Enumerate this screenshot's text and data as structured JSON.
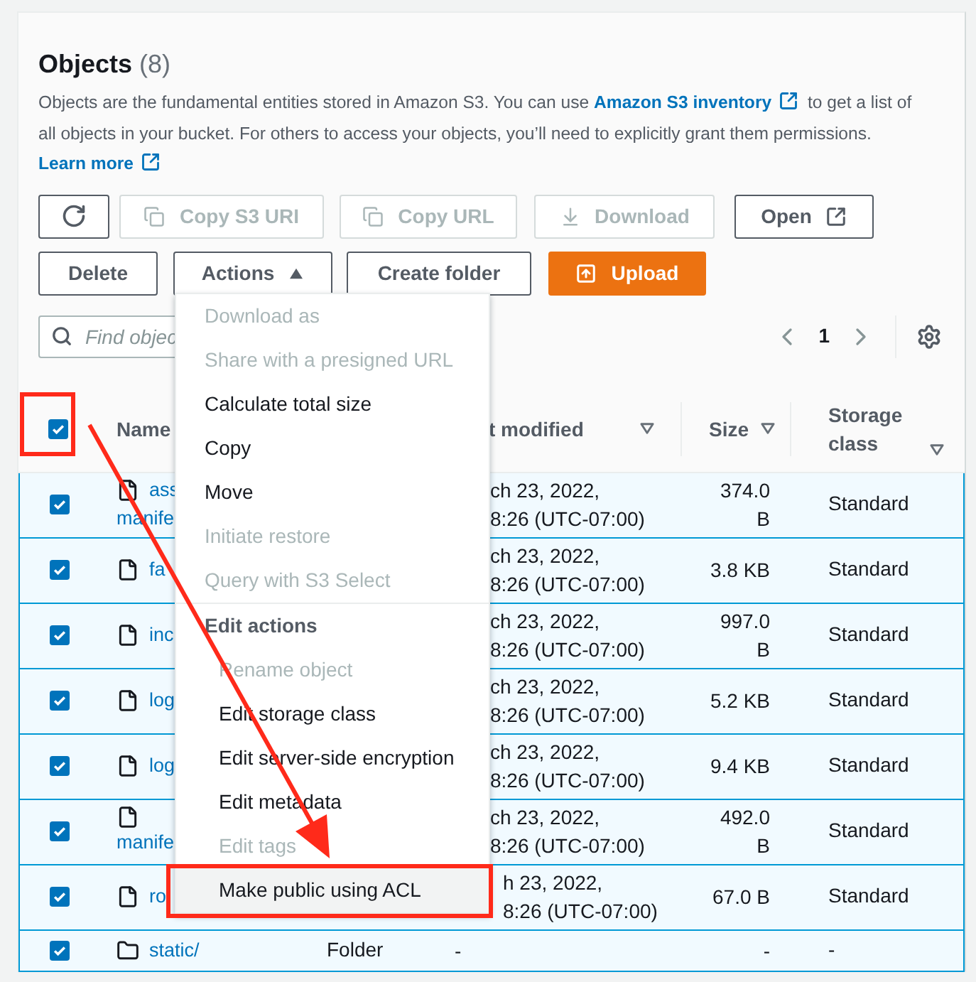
{
  "panel": {
    "title": "Objects",
    "count": "(8)",
    "description": [
      {
        "kind": "text",
        "text": "Objects are the fundamental entities stored in Amazon S3. You can use "
      },
      {
        "kind": "link",
        "text": "Amazon S3 inventory",
        "external": true
      },
      {
        "kind": "text",
        "text": " to get a list of all objects in your bucket. For others to access your objects, you’ll need to explicitly grant them permissions. "
      },
      {
        "kind": "link",
        "text": "Learn more",
        "external": true
      }
    ]
  },
  "toolbar": [
    [
      {
        "kind": "refresh",
        "disabled": false
      },
      {
        "kind": "copy",
        "label": "Copy S3 URI",
        "disabled": true
      },
      {
        "kind": "copy",
        "label": "Copy URL",
        "disabled": true
      },
      {
        "kind": "download",
        "label": "Download",
        "disabled": true
      },
      {
        "kind": "external",
        "label": "Open",
        "disabled": false
      }
    ],
    [
      {
        "kind": "plain",
        "label": "Delete",
        "disabled": false
      },
      {
        "kind": "dropdown",
        "label": "Actions",
        "disabled": false,
        "expanded": true
      },
      {
        "kind": "plain",
        "label": "Create folder",
        "disabled": false
      },
      {
        "kind": "upload",
        "label": "Upload",
        "disabled": false
      }
    ]
  ],
  "search": {
    "placeholder": "Find objec"
  },
  "pagination": {
    "page": "1"
  },
  "table": {
    "select_all": {
      "checked": true
    },
    "columns": [
      {
        "label": "Name",
        "sortable": false
      },
      {
        "label": "t modified",
        "sortable": true
      },
      {
        "label": "Size",
        "sortable": true
      },
      {
        "label": "Storage class",
        "sortable": true
      }
    ],
    "rows": [
      {
        "kind": "file",
        "checked": true,
        "name": [
          "ass",
          "manife"
        ],
        "name_wraps": false,
        "modified": [
          "ch 23, 2022,",
          "8:26 (UTC-07:00)"
        ],
        "size": "374.0 B",
        "storage_class": "Standard"
      },
      {
        "kind": "file",
        "checked": true,
        "name": [
          "fa"
        ],
        "name_wraps": false,
        "modified": [
          "ch 23, 2022,",
          "8:26 (UTC-07:00)"
        ],
        "size": "3.8 KB",
        "storage_class": "Standard"
      },
      {
        "kind": "file",
        "checked": true,
        "name": [
          "inc"
        ],
        "name_wraps": false,
        "modified": [
          "ch 23, 2022,",
          "8:26 (UTC-07:00)"
        ],
        "size": "997.0 B",
        "storage_class": "Standard"
      },
      {
        "kind": "file",
        "checked": true,
        "name": [
          "log"
        ],
        "name_wraps": false,
        "modified": [
          "ch 23, 2022,",
          "8:26 (UTC-07:00)"
        ],
        "size": "5.2 KB",
        "storage_class": "Standard"
      },
      {
        "kind": "file",
        "checked": true,
        "name": [
          "log"
        ],
        "name_wraps": false,
        "modified": [
          "ch 23, 2022,",
          "8:26 (UTC-07:00)"
        ],
        "size": "9.4 KB",
        "storage_class": "Standard"
      },
      {
        "kind": "file",
        "checked": true,
        "name": [
          "manife"
        ],
        "name_wraps": true,
        "modified": [
          "ch 23, 2022,",
          "8:26 (UTC-07:00)"
        ],
        "size": "492.0 B",
        "storage_class": "Standard"
      },
      {
        "kind": "file",
        "checked": true,
        "name": [
          "ro"
        ],
        "name_wraps": false,
        "modified": [
          "h 23, 2022,",
          "8:26 (UTC-07:00)"
        ],
        "size": "67.0 B",
        "storage_class": "Standard"
      },
      {
        "kind": "folder",
        "checked": true,
        "name": [
          "static/"
        ],
        "name_wraps": false,
        "type": "Folder",
        "modified": [
          "-"
        ],
        "size": "-",
        "storage_class": "-"
      }
    ]
  },
  "menu": {
    "items": [
      {
        "kind": "item",
        "label": "Download as",
        "disabled": true,
        "highlighted": false
      },
      {
        "kind": "item",
        "label": "Share with a presigned URL",
        "disabled": true,
        "highlighted": false
      },
      {
        "kind": "item",
        "label": "Calculate total size",
        "disabled": false,
        "highlighted": false
      },
      {
        "kind": "item",
        "label": "Copy",
        "disabled": false,
        "highlighted": false
      },
      {
        "kind": "item",
        "label": "Move",
        "disabled": false,
        "highlighted": false
      },
      {
        "kind": "item",
        "label": "Initiate restore",
        "disabled": true,
        "highlighted": false
      },
      {
        "kind": "item",
        "label": "Query with S3 Select",
        "disabled": true,
        "highlighted": false
      },
      {
        "kind": "group",
        "label": "Edit actions",
        "children": [
          {
            "kind": "item",
            "label": "Rename object",
            "disabled": true,
            "highlighted": false
          },
          {
            "kind": "item",
            "label": "Edit storage class",
            "disabled": false,
            "highlighted": false
          },
          {
            "kind": "item",
            "label": "Edit server-side encryption",
            "disabled": false,
            "highlighted": false
          },
          {
            "kind": "item",
            "label": "Edit metadata",
            "disabled": false,
            "highlighted": false
          },
          {
            "kind": "item",
            "label": "Edit tags",
            "disabled": true,
            "highlighted": false
          },
          {
            "kind": "item",
            "label": "Make public using ACL",
            "disabled": false,
            "highlighted": true
          }
        ]
      }
    ]
  }
}
